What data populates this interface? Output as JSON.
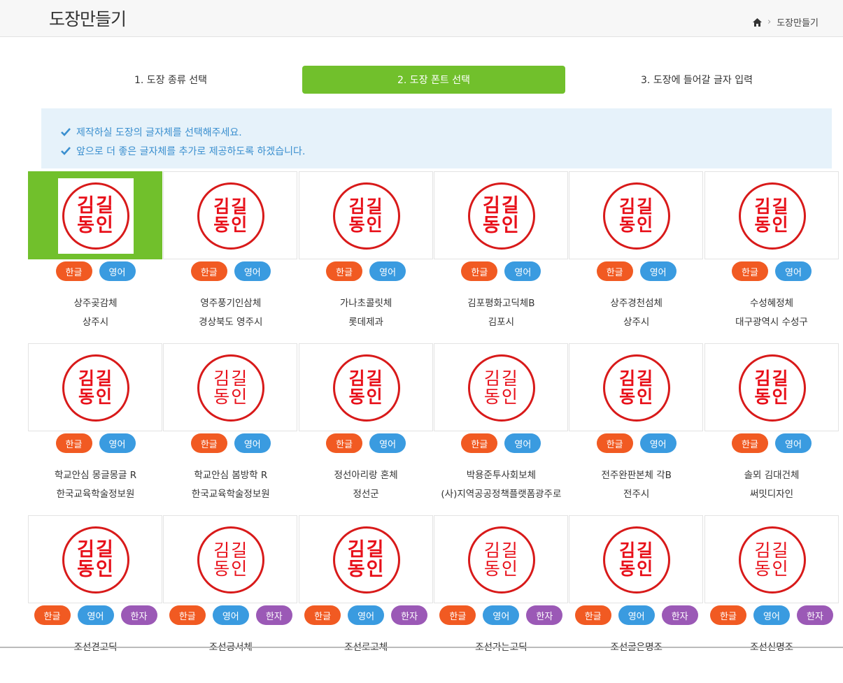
{
  "header": {
    "title": "도장만들기",
    "breadcrumb": {
      "home_icon": "home-icon",
      "current": "도장만들기"
    }
  },
  "steps": [
    {
      "label": "1. 도장 종류 선택",
      "active": false
    },
    {
      "label": "2. 도장 폰트 선택",
      "active": true
    },
    {
      "label": "3. 도장에 들어갈 글자 입력",
      "active": false
    }
  ],
  "notice": {
    "lines": [
      "제작하실 도장의 글자체를 선택해주세요.",
      "앞으로 더 좋은 글자체를 추가로 제공하도록 하겠습니다."
    ]
  },
  "stamp_text": {
    "line1": "김길",
    "line2": "동인"
  },
  "button_labels": {
    "korean": "한글",
    "english": "영어",
    "hanja": "한자"
  },
  "colors": {
    "accent_green": "#71c02c",
    "stamp_red": "#e8101a",
    "btn_korean": "#f15a22",
    "btn_english": "#3a9be0",
    "btn_hanja": "#9b59b6",
    "notice_text": "#3a8fcf"
  },
  "fonts": [
    {
      "name": "상주곶감체",
      "maker": "상주시",
      "selected": true,
      "style": "heavy",
      "hanja": false
    },
    {
      "name": "영주풍기인삼체",
      "maker": "경상북도 영주시",
      "selected": false,
      "style": "bold",
      "hanja": false
    },
    {
      "name": "가나초콜릿체",
      "maker": "롯데제과",
      "selected": false,
      "style": "bold",
      "hanja": false
    },
    {
      "name": "김포평화고딕체B",
      "maker": "김포시",
      "selected": false,
      "style": "heavy",
      "hanja": false
    },
    {
      "name": "상주경천섬체",
      "maker": "상주시",
      "selected": false,
      "style": "bold",
      "hanja": false
    },
    {
      "name": "수성혜정체",
      "maker": "대구광역시 수성구",
      "selected": false,
      "style": "bold",
      "hanja": false
    },
    {
      "name": "학교안심 몽글몽글 R",
      "maker": "한국교육학술정보원",
      "selected": false,
      "style": "bold",
      "hanja": false
    },
    {
      "name": "학교안심 봄방학 R",
      "maker": "한국교육학술정보원",
      "selected": false,
      "style": "light",
      "hanja": false
    },
    {
      "name": "정선아리랑 혼체",
      "maker": "정선군",
      "selected": false,
      "style": "bold",
      "hanja": false
    },
    {
      "name": "박용준투사회보체",
      "maker": "(사)지역공공정책플랫폼광주로",
      "selected": false,
      "style": "light",
      "hanja": false
    },
    {
      "name": "전주완판본체 각B",
      "maker": "전주시",
      "selected": false,
      "style": "bold",
      "hanja": false
    },
    {
      "name": "솔뫼 김대건체",
      "maker": "써밋디자인",
      "selected": false,
      "style": "bold",
      "hanja": false
    },
    {
      "name": "조선견고딕",
      "maker": "",
      "selected": false,
      "style": "heavy",
      "hanja": true
    },
    {
      "name": "조선궁서체",
      "maker": "",
      "selected": false,
      "style": "light",
      "hanja": true
    },
    {
      "name": "조선로고체",
      "maker": "",
      "selected": false,
      "style": "heavy",
      "hanja": true
    },
    {
      "name": "조선가는고딕",
      "maker": "",
      "selected": false,
      "style": "light",
      "hanja": true
    },
    {
      "name": "조선굴은명조",
      "maker": "",
      "selected": false,
      "style": "bold",
      "hanja": true
    },
    {
      "name": "조선신명조",
      "maker": "",
      "selected": false,
      "style": "light",
      "hanja": true
    }
  ]
}
